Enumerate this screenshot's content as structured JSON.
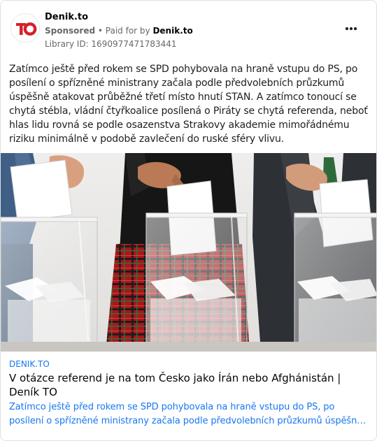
{
  "advertiser": {
    "page_name": "Denik.to",
    "sponsored_label": "Sponsored",
    "separator": " • ",
    "paid_for_prefix": "Paid for by ",
    "paid_for_by": "Denik.to",
    "library_id": "Library ID: 1690977471783441",
    "logo_text": "TO",
    "brand_color": "#d6202a"
  },
  "post": {
    "body": "Zatímco ještě před rokem se SPD pohybovala na hraně vstupu do PS, po posílení o spřízněné ministrany začala podle předvolebních průzkumů úspěšně atakovat průběžné třetí místo hnutí STAN. A zatímco tonoucí se chytá stébla, vládní čtyřkoalice posílená o Piráty se chytá referenda, neboť hlas lidu rovná se podle osazenstva Strakovy akademie mimořádnému riziku minimálně v podobě zavlečení do ruské sféry vlivu."
  },
  "link_preview": {
    "domain": "DENIK.TO",
    "title": "V otázce referend je na tom Česko jako Írán nebo Afghánistán | Deník TO",
    "description": "Zatímco ještě před rokem se SPD pohybovala na hraně vstupu do PS, po posílení o spřízněné ministrany začala podle předvolebních průzkumů úspěšně atakovat průběžné třetí místo hnutí STAN.",
    "link_color": "#1877f2"
  },
  "icons": {
    "more": "more-options-icon",
    "logo": "denik-to-logo-icon"
  }
}
